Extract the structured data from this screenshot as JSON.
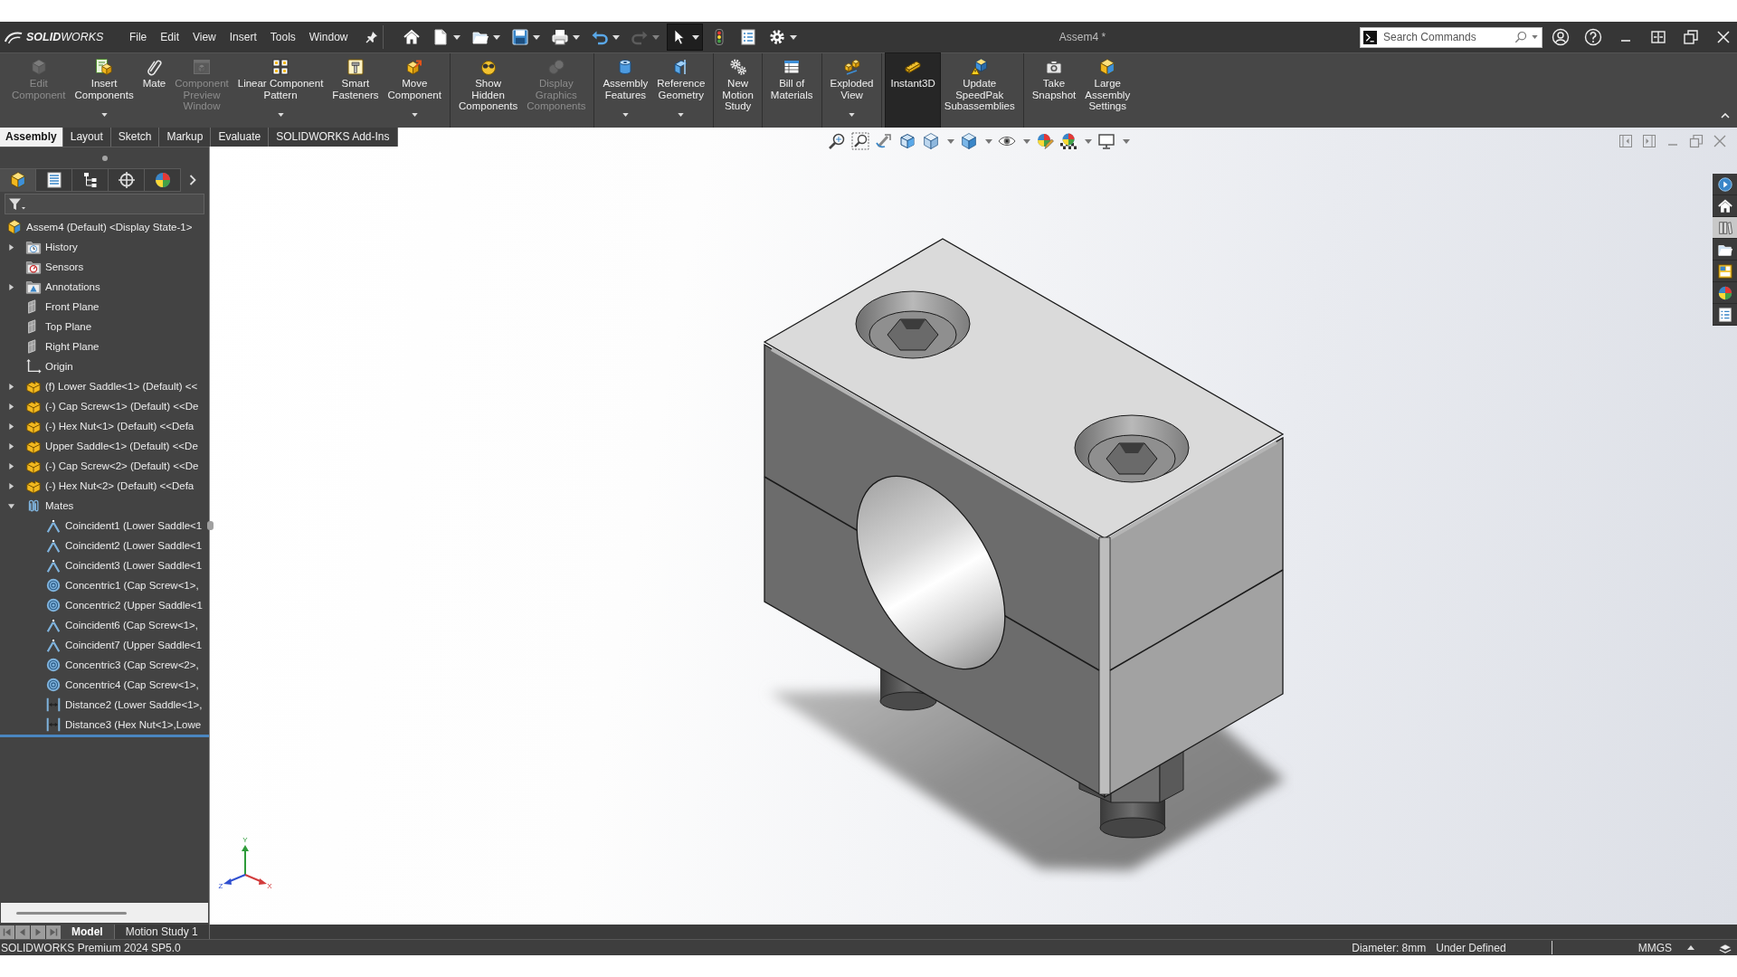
{
  "title_bar": {
    "logo": "**SOLID**WORKS",
    "menus": [
      "File",
      "Edit",
      "View",
      "Insert",
      "Tools",
      "Window"
    ],
    "quick_access": [
      {
        "kind": "home",
        "has_menu": false,
        "selected": false,
        "disabled": false
      },
      {
        "kind": "new",
        "has_menu": true,
        "selected": false,
        "disabled": false
      },
      {
        "kind": "open",
        "has_menu": true,
        "selected": false,
        "disabled": false
      },
      {
        "kind": "save",
        "has_menu": true,
        "selected": false,
        "disabled": false
      },
      {
        "kind": "print",
        "has_menu": true,
        "selected": false,
        "disabled": false
      },
      {
        "kind": "undo",
        "has_menu": true,
        "selected": false,
        "disabled": false
      },
      {
        "kind": "redo",
        "has_menu": true,
        "selected": false,
        "disabled": true
      },
      {
        "kind": "select",
        "has_menu": true,
        "selected": true,
        "disabled": false
      },
      {
        "kind": "rebuild",
        "has_menu": false,
        "selected": false,
        "disabled": false
      },
      {
        "kind": "file-properties",
        "has_menu": false,
        "selected": false,
        "disabled": false
      },
      {
        "kind": "options",
        "has_menu": true,
        "selected": false,
        "disabled": false
      }
    ],
    "document_title": "Assem4 *",
    "search": {
      "placeholder": "Search Commands"
    }
  },
  "command_manager": {
    "groups": [
      {
        "commands": [
          {
            "label": "Edit\nComponent",
            "kind": "edit-component",
            "disabled": true,
            "selected": false,
            "has_menu": false
          },
          {
            "label": "Insert\nComponents",
            "kind": "insert-components",
            "disabled": false,
            "selected": false,
            "has_menu": true
          },
          {
            "label": "Mate",
            "kind": "mate",
            "disabled": false,
            "selected": false,
            "has_menu": false
          },
          {
            "label": "Component\nPreview\nWindow",
            "kind": "component-preview",
            "disabled": true,
            "selected": false,
            "has_menu": false
          },
          {
            "label": "Linear Component\nPattern",
            "kind": "linear-pattern",
            "disabled": false,
            "selected": false,
            "has_menu": true
          },
          {
            "label": "Smart\nFasteners",
            "kind": "smart-fasteners",
            "disabled": false,
            "selected": false,
            "has_menu": false
          },
          {
            "label": "Move\nComponent",
            "kind": "move-component",
            "disabled": false,
            "selected": false,
            "has_menu": true
          }
        ]
      },
      {
        "commands": [
          {
            "label": "Show\nHidden\nComponents",
            "kind": "show-hidden",
            "disabled": false,
            "selected": false,
            "has_menu": false
          },
          {
            "label": "Display\nGraphics\nComponents",
            "kind": "display-graphics",
            "disabled": true,
            "selected": false,
            "has_menu": false
          }
        ]
      },
      {
        "commands": [
          {
            "label": "Assembly\nFeatures",
            "kind": "assembly-features",
            "disabled": false,
            "selected": false,
            "has_menu": true
          },
          {
            "label": "Reference\nGeometry",
            "kind": "reference-geometry",
            "disabled": false,
            "selected": false,
            "has_menu": true
          }
        ]
      },
      {
        "commands": [
          {
            "label": "New\nMotion\nStudy",
            "kind": "new-motion-study",
            "disabled": false,
            "selected": false,
            "has_menu": false
          }
        ]
      },
      {
        "commands": [
          {
            "label": "Bill of\nMaterials",
            "kind": "bill-of-materials",
            "disabled": false,
            "selected": false,
            "has_menu": false
          }
        ]
      },
      {
        "commands": [
          {
            "label": "Exploded\nView",
            "kind": "exploded-view",
            "disabled": false,
            "selected": false,
            "has_menu": true
          }
        ]
      },
      {
        "commands": [
          {
            "label": "Instant3D",
            "kind": "instant3d",
            "disabled": false,
            "selected": true,
            "has_menu": false
          },
          {
            "label": "Update\nSpeedPak\nSubassemblies",
            "kind": "update-speedpak",
            "disabled": false,
            "selected": false,
            "has_menu": false
          }
        ]
      },
      {
        "commands": [
          {
            "label": "Take\nSnapshot",
            "kind": "take-snapshot",
            "disabled": false,
            "selected": false,
            "has_menu": false
          },
          {
            "label": "Large\nAssembly\nSettings",
            "kind": "large-assembly-settings",
            "disabled": false,
            "selected": false,
            "has_menu": false
          }
        ]
      }
    ],
    "tabs": [
      {
        "label": "Assembly",
        "selected": true
      },
      {
        "label": "Layout",
        "selected": false
      },
      {
        "label": "Sketch",
        "selected": false
      },
      {
        "label": "Markup",
        "selected": false
      },
      {
        "label": "Evaluate",
        "selected": false
      },
      {
        "label": "SOLIDWORKS Add-Ins",
        "selected": false
      }
    ]
  },
  "feature_manager": {
    "tabs": [
      {
        "kind": "feature-tree",
        "selected": true
      },
      {
        "kind": "property-manager",
        "selected": false
      },
      {
        "kind": "configuration-manager",
        "selected": false
      },
      {
        "kind": "dimxpert",
        "selected": false
      },
      {
        "kind": "display-manager",
        "selected": false
      }
    ],
    "tree": {
      "label": "Assem4 (Default) <Display State-1>",
      "kind": "assembly",
      "children": [
        {
          "label": "History",
          "kind": "history",
          "expanded": false
        },
        {
          "label": "Sensors",
          "kind": "sensors"
        },
        {
          "label": "Annotations",
          "kind": "annotations",
          "expanded": false
        },
        {
          "label": "Front Plane",
          "kind": "plane"
        },
        {
          "label": "Top Plane",
          "kind": "plane"
        },
        {
          "label": "Right Plane",
          "kind": "plane"
        },
        {
          "label": "Origin",
          "kind": "origin"
        },
        {
          "label": "(f) Lower Saddle<1> (Default) <<",
          "kind": "part",
          "expanded": false
        },
        {
          "label": "(-) Cap Screw<1> (Default) <<De",
          "kind": "part",
          "expanded": false
        },
        {
          "label": "(-) Hex Nut<1> (Default) <<Defa",
          "kind": "part",
          "expanded": false
        },
        {
          "label": "Upper Saddle<1> (Default) <<De",
          "kind": "part",
          "expanded": false
        },
        {
          "label": "(-) Cap Screw<2> (Default) <<De",
          "kind": "part",
          "expanded": false
        },
        {
          "label": "(-) Hex Nut<2> (Default) <<Defa",
          "kind": "part",
          "expanded": false
        },
        {
          "label": "Mates",
          "kind": "mates",
          "expanded": true,
          "children": [
            {
              "label": "Coincident1 (Lower Saddle<1",
              "kind": "coincident"
            },
            {
              "label": "Coincident2 (Lower Saddle<1",
              "kind": "coincident"
            },
            {
              "label": "Coincident3 (Lower Saddle<1",
              "kind": "coincident"
            },
            {
              "label": "Concentric1 (Cap Screw<1>,",
              "kind": "concentric"
            },
            {
              "label": "Concentric2 (Upper Saddle<1",
              "kind": "concentric"
            },
            {
              "label": "Coincident6 (Cap Screw<1>,",
              "kind": "coincident"
            },
            {
              "label": "Coincident7 (Upper Saddle<1",
              "kind": "coincident"
            },
            {
              "label": "Concentric3 (Cap Screw<2>,",
              "kind": "concentric"
            },
            {
              "label": "Concentric4 (Cap Screw<1>,",
              "kind": "concentric"
            },
            {
              "label": "Distance2 (Lower Saddle<1>,",
              "kind": "distance"
            },
            {
              "label": "Distance3 (Hex Nut<1>,Lowe",
              "kind": "distance"
            }
          ]
        }
      ]
    }
  },
  "graphics_area": {
    "view_toolbar": [
      {
        "kind": "zoom-to-fit",
        "has_menu": false
      },
      {
        "kind": "zoom-to-area",
        "has_menu": false
      },
      {
        "kind": "previous-view",
        "has_menu": false
      },
      {
        "kind": "section-view",
        "has_menu": false
      },
      {
        "kind": "view-orientation",
        "has_menu": true
      },
      {
        "kind": "display-style",
        "has_menu": true
      },
      {
        "kind": "hide-show",
        "has_menu": true
      },
      {
        "kind": "edit-appearance",
        "has_menu": false
      },
      {
        "kind": "apply-scene",
        "has_menu": true
      },
      {
        "kind": "view-settings",
        "has_menu": true
      }
    ],
    "task_pane": [
      {
        "kind": "resources",
        "selected": false
      },
      {
        "kind": "home",
        "selected": false
      },
      {
        "kind": "design-library",
        "selected": true
      },
      {
        "kind": "file-explorer",
        "selected": false
      },
      {
        "kind": "view-palette",
        "selected": false
      },
      {
        "kind": "appearances",
        "selected": false
      },
      {
        "kind": "custom-properties",
        "selected": false
      }
    ],
    "axis_labels": [
      "Y",
      "X",
      "Z"
    ]
  },
  "bottom_tabs": [
    {
      "label": "Model",
      "selected": true
    },
    {
      "label": "Motion Study 1",
      "selected": false
    }
  ],
  "status_bar": {
    "product": "SOLIDWORKS Premium 2024 SP5.0",
    "sketch_info": [
      "Diameter: 8mm",
      "Under Defined"
    ],
    "units": "MMGS"
  }
}
